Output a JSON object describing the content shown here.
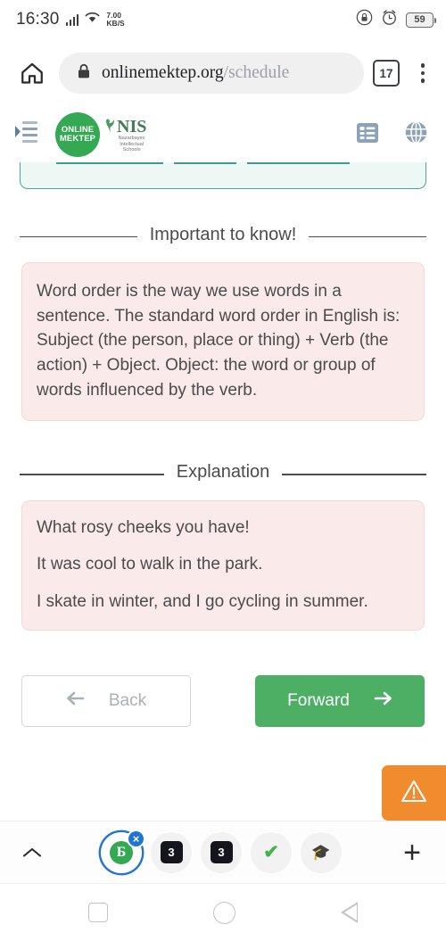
{
  "status_bar": {
    "time": "16:30",
    "network_speed_value": "7.00",
    "network_speed_unit": "KB/S",
    "battery_percent": "59",
    "icons": [
      "signal-bars-icon",
      "wifi-icon",
      "lock-rotation-icon",
      "alarm-clock-icon",
      "battery-icon"
    ]
  },
  "browser": {
    "home_icon": "home-icon",
    "lock_icon": "lock-icon",
    "url_domain": "onlinemektep.org",
    "url_path": "/schedule",
    "tab_count": "17",
    "menu_icon": "kebab-menu-icon"
  },
  "site_header": {
    "menu_icon": "sidebar-toggle-icon",
    "logo_line1": "ONLINE",
    "logo_line2": "MEKTEP",
    "nis_name": "NIS",
    "nis_sub_line1": "Nazarbayev",
    "nis_sub_line2": "Intellectual",
    "nis_sub_line3": "Schools",
    "list_icon": "list-view-icon",
    "globe_icon": "globe-icon"
  },
  "content": {
    "important_heading": "Important to know!",
    "important_text": "Word order is the way we use words in a sentence. The standard word order in English is: Subject (the person, place or thing) + Verb (the action) + Object. Object: the word or group of words influenced by the verb.",
    "explanation_heading": "Explanation",
    "examples": [
      "What rosy cheeks you have!",
      "It was cool to walk in the park.",
      "I skate in winter, and I go cycling in summer."
    ]
  },
  "nav_buttons": {
    "back_label": "Back",
    "back_icon": "arrow-left-icon",
    "forward_label": "Forward",
    "forward_icon": "arrow-right-icon",
    "forward_color": "#4caf64"
  },
  "floating_button": {
    "icon": "warning-triangle-icon",
    "color": "#f08c2e"
  },
  "tab_strip": {
    "expand_icon": "chevron-up-icon",
    "new_tab_icon": "plus-icon",
    "tabs": [
      {
        "icon": "online-mektep-favicon",
        "glyph": "Б",
        "selected": true,
        "close_label": "×"
      },
      {
        "icon": "numeric-3-favicon",
        "glyph": "3",
        "selected": false
      },
      {
        "icon": "numeric-3-favicon",
        "glyph": "3",
        "selected": false
      },
      {
        "icon": "green-check-favicon",
        "glyph": "✔",
        "selected": false
      },
      {
        "icon": "graduation-cap-favicon",
        "glyph": "🎓",
        "selected": false
      }
    ]
  },
  "android_nav": {
    "recents_icon": "square-recents-icon",
    "home_icon": "circle-home-icon",
    "back_icon": "triangle-back-icon"
  }
}
